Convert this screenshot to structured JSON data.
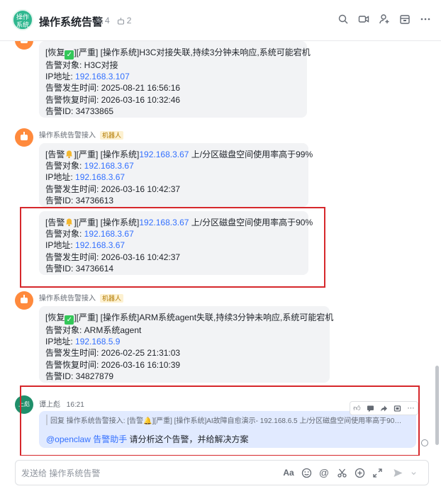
{
  "header": {
    "group_avatar_text": "操作\n系统",
    "title": "操作系统告警",
    "member_count": "4",
    "bot_count": "2",
    "actions": [
      "search-icon",
      "video-icon",
      "add-member-icon",
      "calendar-icon",
      "more-icon"
    ]
  },
  "messages": [
    {
      "lines": [
        {
          "pre": "[恢复",
          "emoji": "check",
          "post": "][严重] [操作系统]H3C对接失联,持续3分钟未响应,系统可能宕机"
        },
        {
          "label": "告警对象: ",
          "value": "H3C对接"
        },
        {
          "label": "IP地址: ",
          "link": "192.168.3.107"
        },
        {
          "label": "告警发生时间: ",
          "value": "2025-08-21 16:56:16"
        },
        {
          "label": "告警恢复时间: ",
          "value": "2026-03-16 10:32:46"
        },
        {
          "label": "告警ID: ",
          "value": "34733865"
        }
      ]
    },
    {
      "sender": "操作系统告警接入",
      "tag": "机器人",
      "lines": [
        {
          "pre": "[告警",
          "emoji": "bell",
          "post": "][严重] [操作系统]",
          "link": "192.168.3.67",
          "tail": " 上/分区磁盘空间使用率高于99%"
        },
        {
          "label": "告警对象: ",
          "link": "192.168.3.67"
        },
        {
          "label": "IP地址: ",
          "link": "192.168.3.67"
        },
        {
          "label": "告警发生时间: ",
          "value": "2026-03-16 10:42:37"
        },
        {
          "label": "告警ID: ",
          "value": "34736613"
        }
      ]
    },
    {
      "lines": [
        {
          "pre": "[告警",
          "emoji": "bell",
          "post": "][严重] [操作系统]",
          "link": "192.168.3.67",
          "tail": " 上/分区磁盘空间使用率高于90%"
        },
        {
          "label": "告警对象: ",
          "link": "192.168.3.67"
        },
        {
          "label": "IP地址: ",
          "link": "192.168.3.67"
        },
        {
          "label": "告警发生时间: ",
          "value": "2026-03-16 10:42:37"
        },
        {
          "label": "告警ID: ",
          "value": "34736614"
        }
      ]
    },
    {
      "sender": "操作系统告警接入",
      "tag": "机器人",
      "lines": [
        {
          "pre": "[恢复",
          "emoji": "check",
          "post": "][严重] [操作系统]ARM系统agent失联,持续3分钟未响应,系统可能宕机"
        },
        {
          "label": "告警对象: ",
          "value": "ARM系统agent"
        },
        {
          "label": "IP地址: ",
          "link": "192.168.5.9"
        },
        {
          "label": "告警发生时间: ",
          "value": "2026-02-25 21:31:03"
        },
        {
          "label": "告警恢复时间: ",
          "value": "2026-03-16 16:10:39"
        },
        {
          "label": "告警ID: ",
          "value": "34827879"
        }
      ]
    }
  ],
  "reply": {
    "avatar_text": "上彪",
    "sender": "谭上彪",
    "time": "16:21",
    "quote": "回复 操作系统告警接入: [告警🔔][严重] [操作系统]AI故障自愈演示- 192.168.6.5 上/分区磁盘空间使用率高于90% 告...",
    "mention": "@openclaw 告警助手",
    "text": " 请分析这个告警，并给解决方案",
    "hover_actions": [
      "thumbs-up-icon",
      "comment-icon",
      "forward-icon",
      "pin-icon",
      "more-icon"
    ]
  },
  "composer": {
    "placeholder": "发送给 操作系统告警",
    "tools": [
      "font-icon",
      "emoji-icon",
      "mention-icon",
      "scissors-icon",
      "add-icon",
      "expand-icon",
      "send-icon",
      "chevron-down-icon"
    ]
  }
}
